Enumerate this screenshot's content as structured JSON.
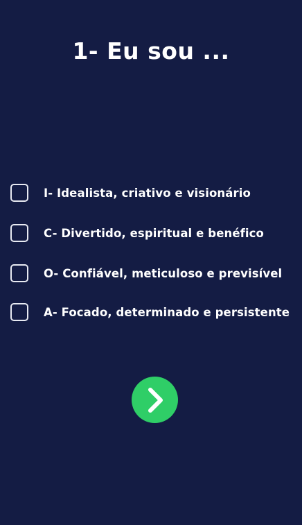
{
  "question": {
    "title": "1- Eu sou ..."
  },
  "options": [
    {
      "label": "I- Idealista, criativo e visionário",
      "checked": false
    },
    {
      "label": "C- Divertido, espiritual e benéfico",
      "checked": false
    },
    {
      "label": "O- Confiável, meticuloso e previsível",
      "checked": false
    },
    {
      "label": "A- Focado, determinado e persistente",
      "checked": false
    }
  ],
  "next_button": {
    "icon": "chevron-right-icon",
    "color": "#2fce67"
  },
  "colors": {
    "background": "#141c44",
    "text": "#ffffff",
    "checkbox_border": "#e8eaf2"
  }
}
